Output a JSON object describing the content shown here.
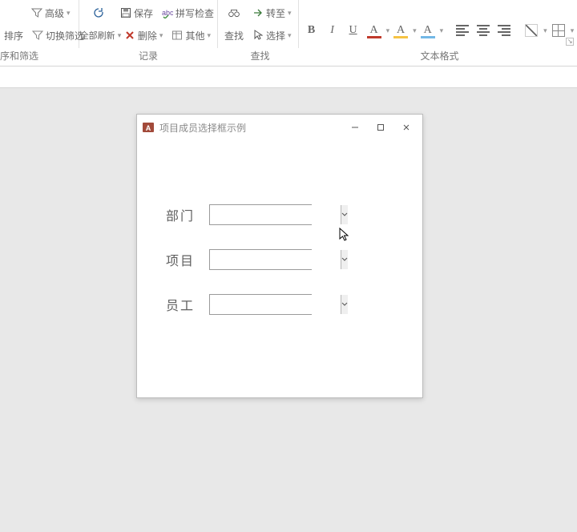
{
  "ribbon": {
    "group_sortfilter": {
      "label": "序和筛选",
      "advanced": "高级",
      "sort": "排序",
      "toggle_filter": "切换筛选"
    },
    "group_records": {
      "label": "记录",
      "refresh_all": "全部刷新",
      "save": "保存",
      "spellcheck": "拼写检查",
      "delete": "删除",
      "other": "其他"
    },
    "group_find": {
      "label": "查找",
      "find": "查找",
      "goto": "转至",
      "select": "选择"
    },
    "group_textfmt": {
      "label": "文本格式",
      "bold": "B",
      "italic": "I",
      "underline": "U",
      "fontcolor": "A",
      "highlight1": "A",
      "highlight2": "A"
    }
  },
  "dialog": {
    "title": "项目成员选择框示例",
    "fields": {
      "dept": {
        "label": "部门",
        "value": ""
      },
      "project": {
        "label": "项目",
        "value": ""
      },
      "staff": {
        "label": "员工",
        "value": ""
      }
    }
  }
}
